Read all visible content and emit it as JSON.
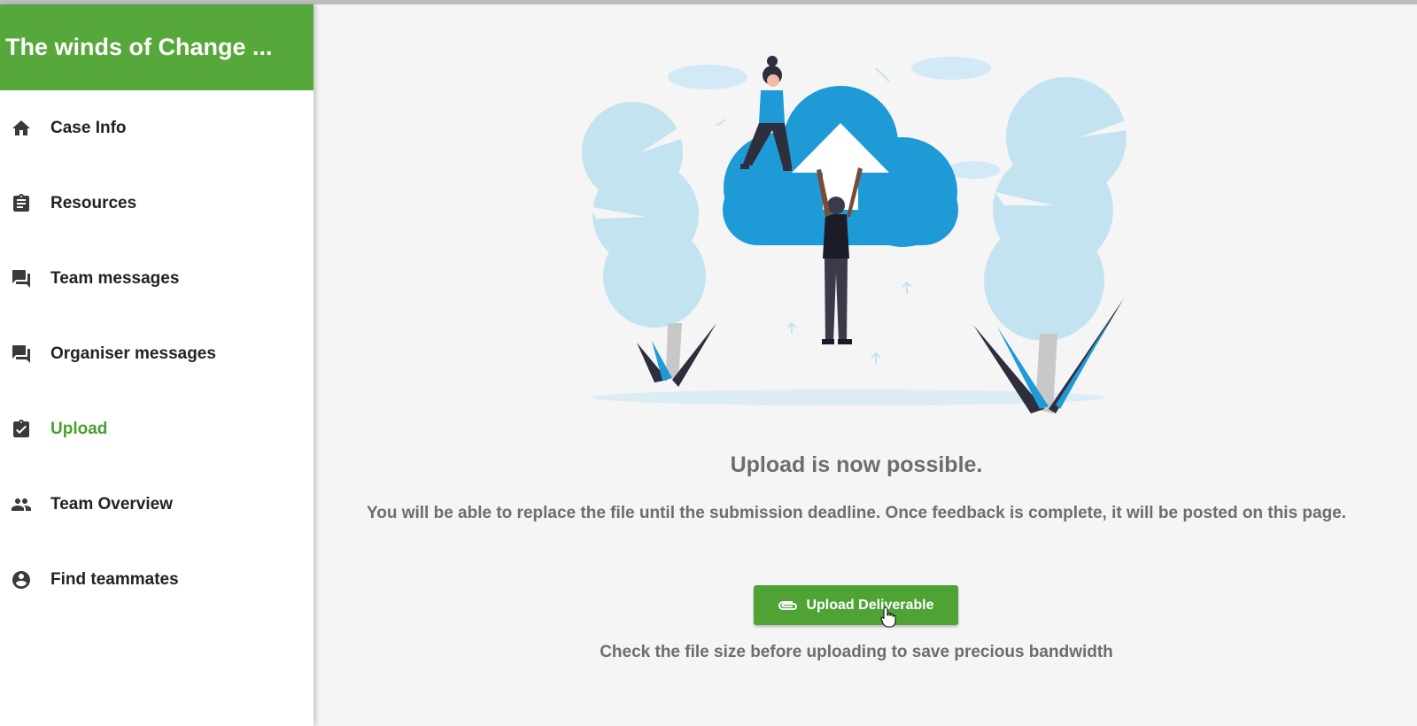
{
  "app": {
    "title": "The winds of Change ..."
  },
  "sidebar": {
    "items": [
      {
        "label": "Case Info",
        "icon": "home-icon",
        "active": false
      },
      {
        "label": "Resources",
        "icon": "clipboard-icon",
        "active": false
      },
      {
        "label": "Team messages",
        "icon": "forum-icon",
        "active": false
      },
      {
        "label": "Organiser messages",
        "icon": "forum-icon",
        "active": false
      },
      {
        "label": "Upload",
        "icon": "assignment-check-icon",
        "active": true
      },
      {
        "label": "Team Overview",
        "icon": "people-icon",
        "active": false
      },
      {
        "label": "Find teammates",
        "icon": "account-circle-icon",
        "active": false
      }
    ]
  },
  "main": {
    "illustration": "cloud-upload-illustration",
    "heading": "Upload is now possible.",
    "description": "You will be able to replace the file until the submission deadline. Once feedback is complete, it will be posted on this page.",
    "upload_button": {
      "label": "Upload Deliverable",
      "icon": "attachment-icon"
    },
    "hint": "Check the file size before uploading to save precious bandwidth"
  },
  "colors": {
    "brand": "#57a83a",
    "active": "#4ca030",
    "cloud": "#1e9ad6",
    "tree": "#c4e3f1"
  }
}
